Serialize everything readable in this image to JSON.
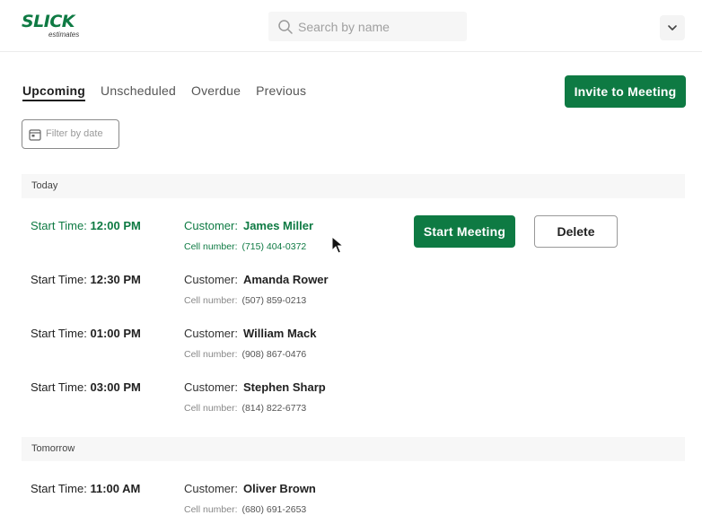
{
  "brand": {
    "name": "SLICK",
    "sub": "estimates",
    "color": "#0e7a43"
  },
  "search": {
    "placeholder": "Search by name",
    "value": ""
  },
  "account_menu": {
    "icon": "chevron-down-icon"
  },
  "tabs": [
    {
      "label": "Upcoming",
      "active": true
    },
    {
      "label": "Unscheduled",
      "active": false
    },
    {
      "label": "Overdue",
      "active": false
    },
    {
      "label": "Previous",
      "active": false
    }
  ],
  "invite_button": {
    "label": "Invite to Meeting"
  },
  "filter": {
    "label": "Filter by date",
    "icon": "calendar-icon"
  },
  "labels": {
    "start_time": "Start Time:",
    "customer": "Customer:",
    "cell_number": "Cell number:"
  },
  "actions": {
    "start_meeting": "Start Meeting",
    "delete": "Delete"
  },
  "sections": [
    {
      "title": "Today",
      "meetings": [
        {
          "time": "12:00 PM",
          "customer": "James Miller",
          "cell": "(715) 404-0372",
          "highlighted": true
        },
        {
          "time": "12:30 PM",
          "customer": "Amanda Rower",
          "cell": "(507) 859-0213"
        },
        {
          "time": "01:00 PM",
          "customer": "William Mack",
          "cell": "(908) 867-0476"
        },
        {
          "time": "03:00 PM",
          "customer": "Stephen Sharp",
          "cell": "(814) 822-6773"
        }
      ]
    },
    {
      "title": "Tomorrow",
      "meetings": [
        {
          "time": "11:00 AM",
          "customer": "Oliver Brown",
          "cell": "(680) 691-2653"
        }
      ]
    }
  ]
}
